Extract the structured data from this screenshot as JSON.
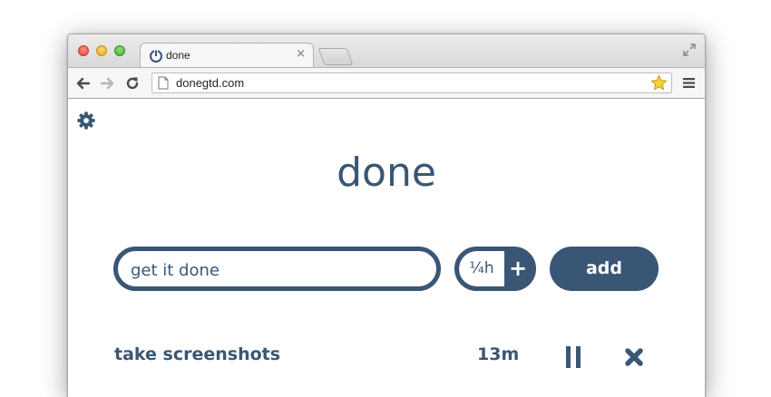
{
  "browser": {
    "tab": {
      "title": "done",
      "close_glyph": "×"
    },
    "address_bar": {
      "url": "donegtd.com"
    },
    "icons": {
      "back": "back-arrow-icon",
      "forward": "forward-arrow-icon",
      "reload": "reload-icon",
      "bookmark": "star-icon",
      "menu": "hamburger-menu-icon",
      "fullscreen": "fullscreen-icon"
    }
  },
  "app": {
    "settings_icon": "gear-icon",
    "title": "done",
    "task_input": {
      "value": "get it done"
    },
    "time_picker": {
      "value": "¼h",
      "increment_glyph": "+"
    },
    "add_label": "add",
    "tasks": [
      {
        "name": "take screenshots",
        "elapsed": "13m",
        "pause_icon": "pause-icon",
        "delete_icon": "close-icon"
      }
    ]
  },
  "colors": {
    "accent": "#3a5675",
    "background": "#ffffff"
  }
}
